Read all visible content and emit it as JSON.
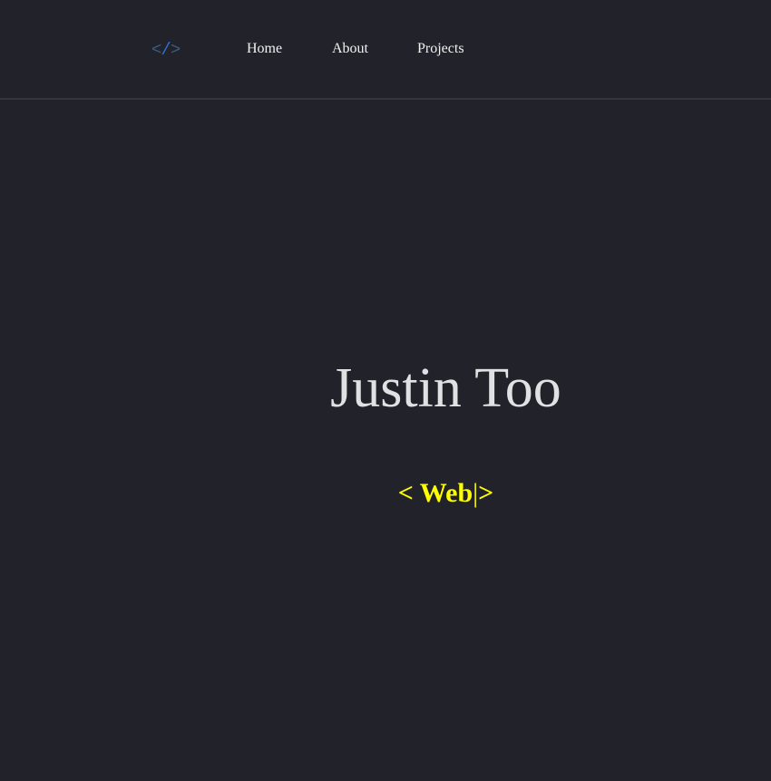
{
  "nav": {
    "logo": {
      "icon": "code-icon",
      "open": "<",
      "slash": "/",
      "close": ">"
    },
    "links": [
      {
        "label": "Home"
      },
      {
        "label": "About"
      },
      {
        "label": "Projects"
      }
    ]
  },
  "hero": {
    "name": "Justin Too",
    "role_prefix": "< ",
    "role_word": "Web",
    "role_cursor": "|",
    "role_suffix": ">"
  },
  "colors": {
    "background": "#22232a",
    "name_text": "#e1e1e3",
    "role_text": "#ffff00",
    "logo_bracket": "#3d5a80",
    "logo_slash": "#2f6fd0"
  }
}
